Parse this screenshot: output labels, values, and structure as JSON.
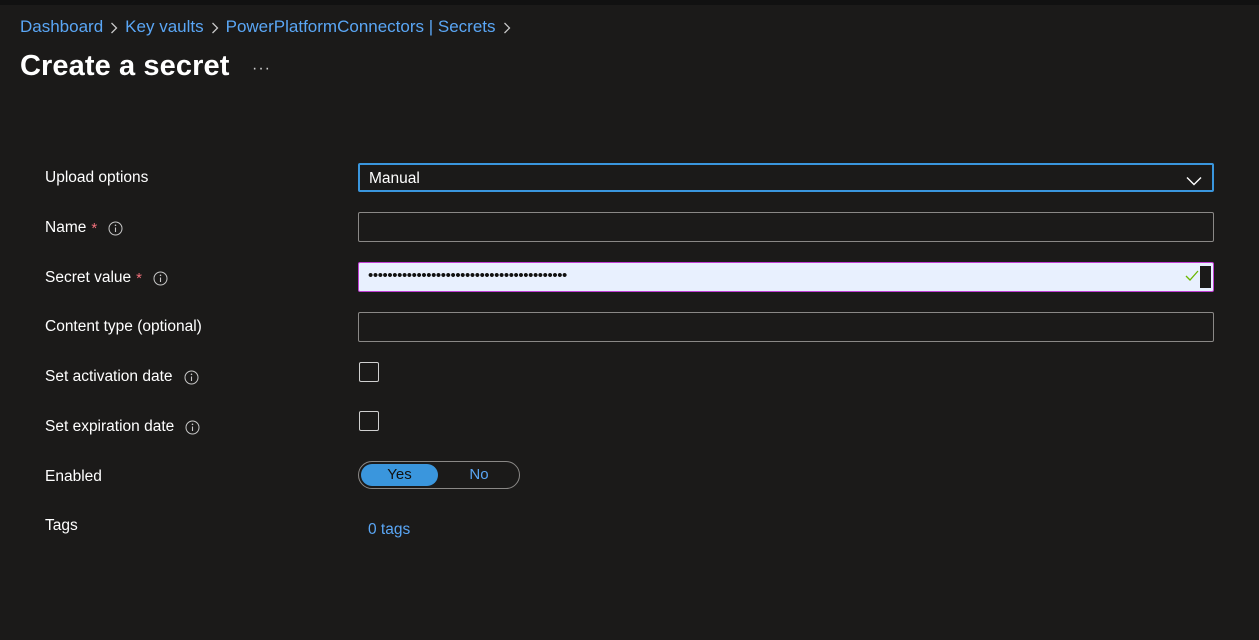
{
  "breadcrumb": {
    "items": [
      {
        "label": "Dashboard"
      },
      {
        "label": "Key vaults"
      },
      {
        "label": "PowerPlatformConnectors | Secrets"
      }
    ]
  },
  "page": {
    "title": "Create a secret",
    "more_label": "···"
  },
  "form": {
    "upload_options": {
      "label": "Upload options",
      "value": "Manual"
    },
    "name": {
      "label": "Name",
      "required_mark": "*",
      "value": ""
    },
    "secret_value": {
      "label": "Secret value",
      "required_mark": "*",
      "value": "•••••••••••••••••••••••••••••••••••••••••"
    },
    "content_type": {
      "label": "Content type (optional)",
      "value": ""
    },
    "activation_date": {
      "label": "Set activation date",
      "checked": false
    },
    "expiration_date": {
      "label": "Set expiration date",
      "checked": false
    },
    "enabled": {
      "label": "Enabled",
      "yes_label": "Yes",
      "no_label": "No",
      "selected": "Yes"
    },
    "tags": {
      "label": "Tags",
      "link_text": "0 tags"
    }
  },
  "colors": {
    "background": "#1b1a19",
    "link": "#5aa6f5",
    "accent": "#3a96dd",
    "required": "#f1707b",
    "secret_field_bg": "#e8f0fe",
    "secret_field_border": "#c03fd3"
  },
  "icons": [
    "chevron-right-icon",
    "info-icon",
    "chevron-down-icon",
    "checkmark-icon",
    "more-icon"
  ]
}
